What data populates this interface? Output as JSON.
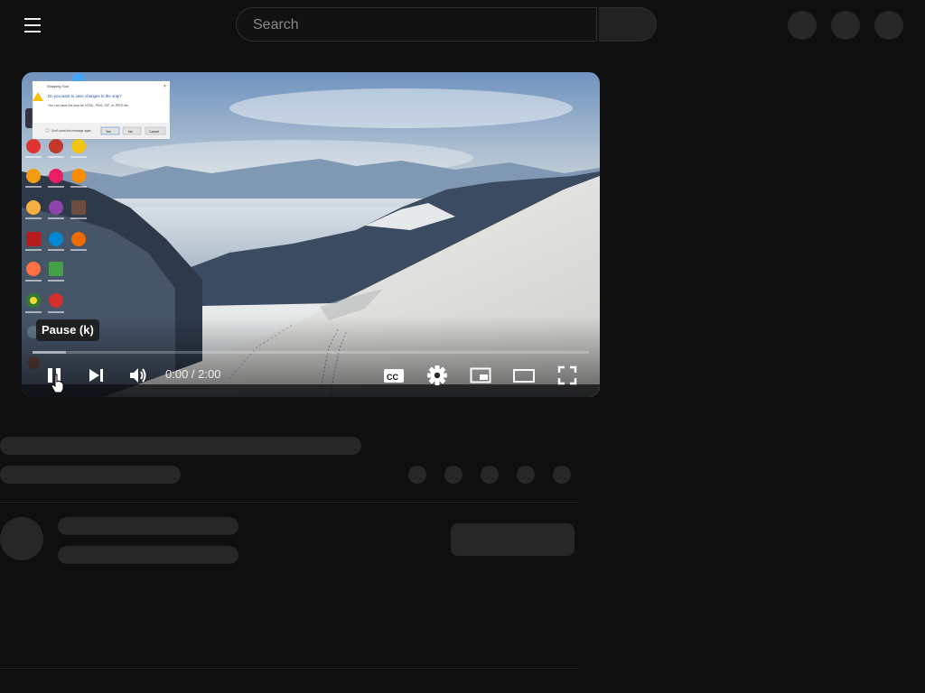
{
  "header": {
    "search_placeholder": "Search",
    "icons": [
      "menu-icon",
      "search-icon",
      "create-icon",
      "notifications-icon",
      "avatar"
    ]
  },
  "player": {
    "tooltip": "Pause (k)",
    "time_current": "0:00",
    "time_separator": " / ",
    "time_total": "2:00",
    "progress_played_fraction": 0.0,
    "progress_buffered_fraction": 0.06,
    "controls": [
      "pause-icon",
      "next-icon",
      "volume-icon",
      "captions-icon",
      "settings-icon",
      "miniplayer-icon",
      "theater-mode-icon",
      "fullscreen-icon"
    ],
    "colors": {
      "progress_played": "#ff0000",
      "track": "#ffffff40"
    }
  },
  "video_frame": {
    "dialog_title": "Snipping Tool",
    "dialog_message": "Do you want to save changes to the snip?",
    "dialog_detail": "You can save the snip as HTML, PNG, GIF, or JPEG file.",
    "dialog_checkbox": "Don't show this message again",
    "dialog_buttons": [
      "Yes",
      "No",
      "Cancel"
    ]
  },
  "theme": {
    "background": "#0f0f0f",
    "skeleton": "#272727"
  }
}
